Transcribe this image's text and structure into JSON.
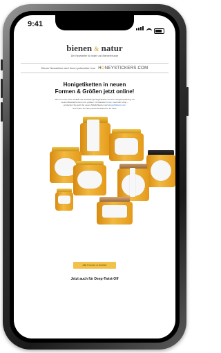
{
  "status": {
    "time": "9:41"
  },
  "email": {
    "top_left": "",
    "top_right": "",
    "brand_left": "bienen",
    "brand_amp": "&",
    "brand_right": "natur",
    "tagline": "Der Newsletter für Imker und Bienenfreunde",
    "sponsor_text": "Dieser Newsletter wird Ihnen präsentiert von",
    "sponsor_logo_h": "H",
    "sponsor_logo_o": "O",
    "sponsor_logo_rest": "NEYSTICKERS.COM",
    "headline_1": "Honigetiketten in neuen",
    "headline_2": "Formen & Größen jetzt online!",
    "body_1": "Jetzt zu noch mehr Vielfalt und Gestaltungsmöglichkeiten für Ihre Honigverpackung mit",
    "body_2": "neuen Etikettenformen und -größen. Ob klassisch rund, oval oder eckig –",
    "body_3": "entdecken Sie jetzt die neuen Möglichkeiten auf",
    "body_link": "HoneyStickers.com",
    "body_4": "und finden Sie das passende Etikett für Ihr Glas.",
    "cta_label": "Alle Formen & Größen",
    "subheadline": "Jetzt auch für Deep-Twist-Off"
  },
  "colors": {
    "accent": "#e8a71e",
    "honey": "#f2b940",
    "cta": "#f2c14a"
  },
  "icons": [
    "signal-icon",
    "wifi-icon",
    "battery-icon"
  ]
}
